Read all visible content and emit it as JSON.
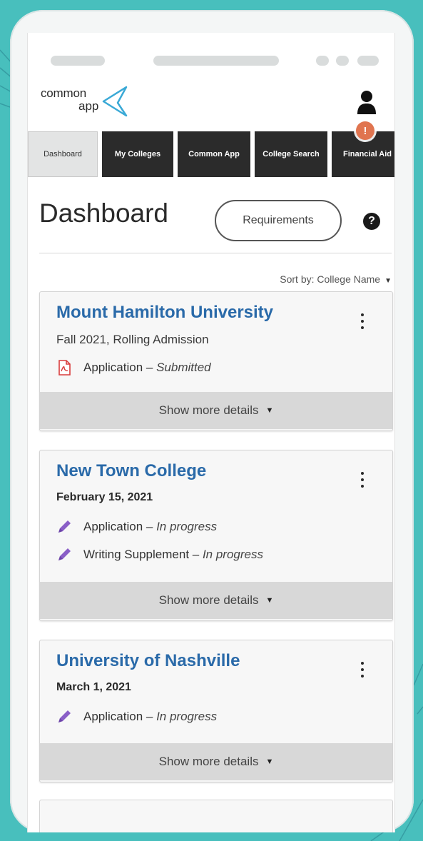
{
  "app": {
    "logo_common": "common",
    "logo_app": "app",
    "notification_badge": "!"
  },
  "tabs": [
    {
      "label": "Dashboard",
      "active": true
    },
    {
      "label": "My Colleges",
      "active": false
    },
    {
      "label": "Common App",
      "active": false
    },
    {
      "label": "College Search",
      "active": false
    },
    {
      "label": "Financial Aid",
      "active": false
    }
  ],
  "page": {
    "title": "Dashboard",
    "requirements_label": "Requirements",
    "help_glyph": "?",
    "sort_label": "Sort by: College Name"
  },
  "colleges": [
    {
      "name": "Mount Hamilton University",
      "subtitle": "Fall 2021, Rolling Admission",
      "items": [
        {
          "icon": "pdf-icon",
          "label": "Application",
          "status": "Submitted"
        }
      ],
      "details_label": "Show more details"
    },
    {
      "name": "New Town College",
      "subtitle": "February 15, 2021",
      "items": [
        {
          "icon": "pencil-icon",
          "label": "Application",
          "status": "In progress"
        },
        {
          "icon": "pencil-icon",
          "label": "Writing Supplement",
          "status": "In progress"
        }
      ],
      "details_label": "Show more details"
    },
    {
      "name": "University of Nashville",
      "subtitle": "March 1, 2021",
      "items": [
        {
          "icon": "pencil-icon",
          "label": "Application",
          "status": "In progress"
        }
      ],
      "details_label": "Show more details"
    }
  ],
  "colors": {
    "background": "#48bfbd",
    "accent_blue": "#2a6aa9",
    "tab_dark": "#2b2b2b",
    "notification": "#e0744f",
    "pencil": "#8a5fc7",
    "pdf": "#d93c3c"
  }
}
